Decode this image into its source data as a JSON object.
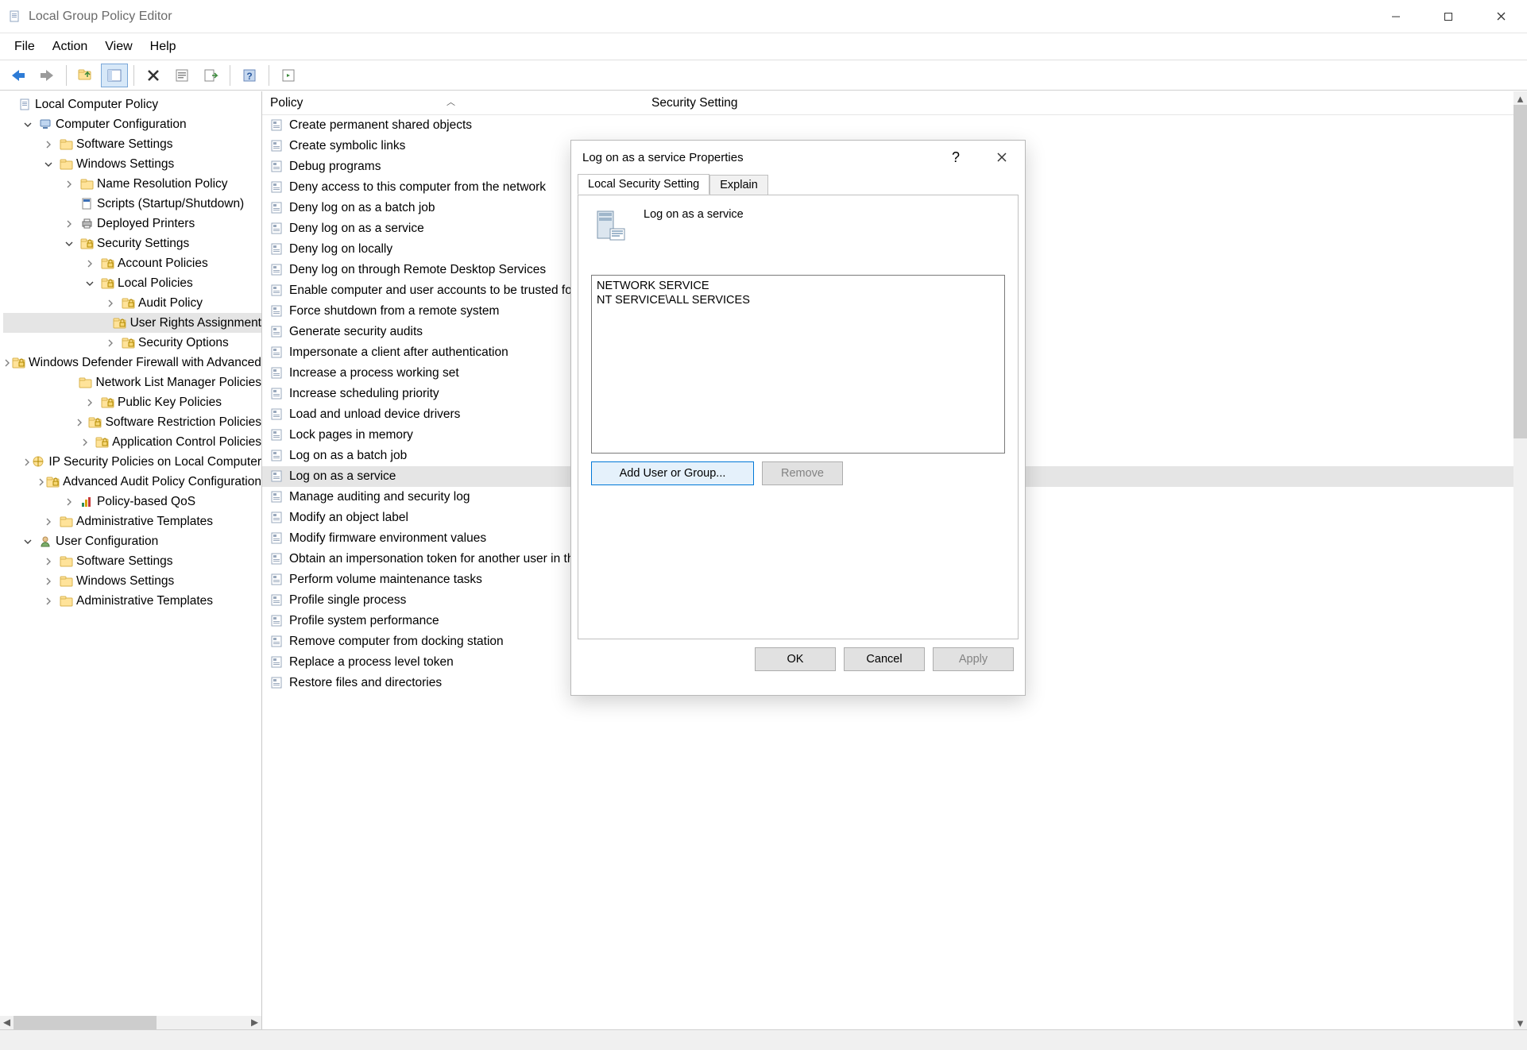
{
  "window": {
    "title": "Local Group Policy Editor"
  },
  "menu": [
    "File",
    "Action",
    "View",
    "Help"
  ],
  "tree": [
    {
      "d": 0,
      "chev": "",
      "icon": "doc",
      "label": "Local Computer Policy"
    },
    {
      "d": 1,
      "chev": "v",
      "icon": "pc",
      "label": "Computer Configuration"
    },
    {
      "d": 2,
      "chev": ">",
      "icon": "folder",
      "label": "Software Settings"
    },
    {
      "d": 2,
      "chev": "v",
      "icon": "folder",
      "label": "Windows Settings"
    },
    {
      "d": 3,
      "chev": ">",
      "icon": "folder",
      "label": "Name Resolution Policy"
    },
    {
      "d": 3,
      "chev": "",
      "icon": "script",
      "label": "Scripts (Startup/Shutdown)"
    },
    {
      "d": 3,
      "chev": ">",
      "icon": "printer",
      "label": "Deployed Printers"
    },
    {
      "d": 3,
      "chev": "v",
      "icon": "lockfolder",
      "label": "Security Settings"
    },
    {
      "d": 4,
      "chev": ">",
      "icon": "lockfolder",
      "label": "Account Policies"
    },
    {
      "d": 4,
      "chev": "v",
      "icon": "lockfolder",
      "label": "Local Policies"
    },
    {
      "d": 5,
      "chev": ">",
      "icon": "lockfolder",
      "label": "Audit Policy"
    },
    {
      "d": 5,
      "chev": "",
      "icon": "lockfolder",
      "label": "User Rights Assignment",
      "sel": true
    },
    {
      "d": 5,
      "chev": ">",
      "icon": "lockfolder",
      "label": "Security Options"
    },
    {
      "d": 4,
      "chev": ">",
      "icon": "lockfolder",
      "label": "Windows Defender Firewall with Advanced Security"
    },
    {
      "d": 4,
      "chev": "",
      "icon": "folder",
      "label": "Network List Manager Policies"
    },
    {
      "d": 4,
      "chev": ">",
      "icon": "lockfolder",
      "label": "Public Key Policies"
    },
    {
      "d": 4,
      "chev": ">",
      "icon": "lockfolder",
      "label": "Software Restriction Policies"
    },
    {
      "d": 4,
      "chev": ">",
      "icon": "lockfolder",
      "label": "Application Control Policies"
    },
    {
      "d": 4,
      "chev": ">",
      "icon": "ipsec",
      "label": "IP Security Policies on Local Computer"
    },
    {
      "d": 4,
      "chev": ">",
      "icon": "lockfolder",
      "label": "Advanced Audit Policy Configuration"
    },
    {
      "d": 3,
      "chev": ">",
      "icon": "qos",
      "label": "Policy-based QoS"
    },
    {
      "d": 2,
      "chev": ">",
      "icon": "folder",
      "label": "Administrative Templates"
    },
    {
      "d": 1,
      "chev": "v",
      "icon": "user",
      "label": "User Configuration"
    },
    {
      "d": 2,
      "chev": ">",
      "icon": "folder",
      "label": "Software Settings"
    },
    {
      "d": 2,
      "chev": ">",
      "icon": "folder",
      "label": "Windows Settings"
    },
    {
      "d": 2,
      "chev": ">",
      "icon": "folder",
      "label": "Administrative Templates"
    }
  ],
  "columns": {
    "policy": "Policy",
    "setting": "Security Setting"
  },
  "policies": [
    "Create permanent shared objects",
    "Create symbolic links",
    "Debug programs",
    "Deny access to this computer from the network",
    "Deny log on as a batch job",
    "Deny log on as a service",
    "Deny log on locally",
    "Deny log on through Remote Desktop Services",
    "Enable computer and user accounts to be trusted for delegation",
    "Force shutdown from a remote system",
    "Generate security audits",
    "Impersonate a client after authentication",
    "Increase a process working set",
    "Increase scheduling priority",
    "Load and unload device drivers",
    "Lock pages in memory",
    "Log on as a batch job",
    "Log on as a service",
    "Manage auditing and security log",
    "Modify an object label",
    "Modify firmware environment values",
    "Obtain an impersonation token for another user in the same session",
    "Perform volume maintenance tasks",
    "Profile single process",
    "Profile system performance",
    "Remove computer from docking station",
    "Replace a process level token",
    "Restore files and directories"
  ],
  "selected_policy_index": 17,
  "dialog": {
    "title": "Log on as a service Properties",
    "policy_name": "Log on as a service",
    "tabs": [
      "Local Security Setting",
      "Explain"
    ],
    "members": [
      "NETWORK SERVICE",
      "NT SERVICE\\ALL SERVICES"
    ],
    "add": "Add User or Group...",
    "remove": "Remove",
    "ok": "OK",
    "cancel": "Cancel",
    "apply": "Apply"
  }
}
